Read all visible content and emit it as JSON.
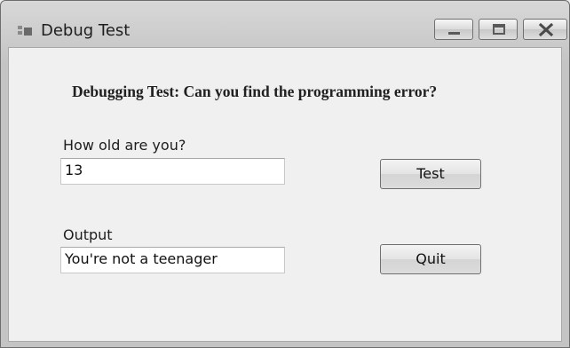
{
  "window": {
    "title": "Debug Test",
    "controls": [
      "minimize-icon",
      "maximize-icon",
      "close-icon"
    ]
  },
  "form": {
    "heading": "Debugging Test: Can you find the programming error?",
    "age_label": "How old are you?",
    "age_value": "13",
    "output_label": "Output",
    "output_value": "You're not a teenager",
    "test_button": "Test",
    "quit_button": "Quit"
  }
}
